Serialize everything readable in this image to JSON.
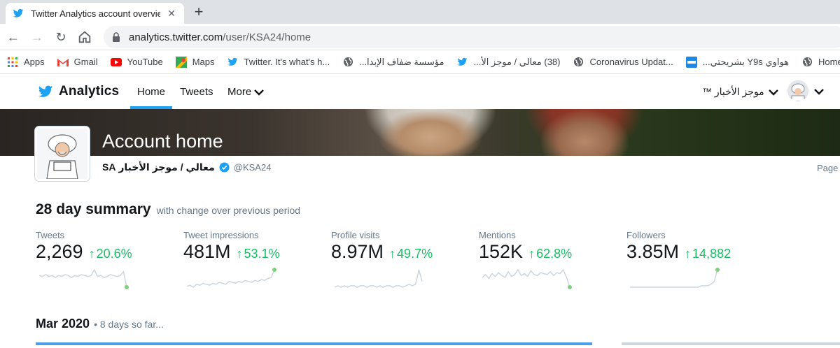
{
  "browser": {
    "tab_title": "Twitter Analytics account overvie",
    "url_domain": "analytics.twitter.com",
    "url_path": "/user/KSA24/home",
    "bookmarks": [
      {
        "label": "Apps",
        "icon": "apps-grid-icon"
      },
      {
        "label": "Gmail",
        "icon": "gmail-icon"
      },
      {
        "label": "YouTube",
        "icon": "youtube-icon"
      },
      {
        "label": "Maps",
        "icon": "maps-icon"
      },
      {
        "label": "Twitter. It's what's h...",
        "icon": "twitter-bird-icon"
      },
      {
        "label": "مؤسسة ضفاف الإبدا...",
        "icon": "globe-icon"
      },
      {
        "label": "(38) معالي / موجز الأ...",
        "icon": "twitter-bird-icon"
      },
      {
        "label": "Coronavirus Updat...",
        "icon": "globe-icon"
      },
      {
        "label": "هواوي Y9s بشريحتي...",
        "icon": "store-icon"
      },
      {
        "label": "Home -",
        "icon": "globe-icon"
      }
    ]
  },
  "nav": {
    "brand": "Analytics",
    "items": [
      "Home",
      "Tweets",
      "More"
    ],
    "account_name": "موجز الأخبار ™"
  },
  "header": {
    "title": "Account home",
    "display_name": "معالي / موجز الأخبار SA",
    "handle": "@KSA24",
    "page_link": "Page"
  },
  "summary": {
    "title": "28 day summary",
    "subtitle": "with change over previous period",
    "metrics": [
      {
        "label": "Tweets",
        "value": "2,269",
        "change": "20.6%",
        "spark": [
          6,
          5,
          7,
          5,
          6,
          4,
          6,
          5,
          7,
          6,
          4,
          6,
          5,
          7,
          6,
          5,
          6,
          12,
          5,
          6,
          4,
          5,
          7,
          6,
          5,
          6,
          10,
          -6
        ],
        "end_point": true
      },
      {
        "label": "Tweet impressions",
        "value": "481M",
        "change": "53.1%",
        "spark": [
          3,
          4,
          2,
          5,
          4,
          6,
          5,
          4,
          6,
          5,
          7,
          6,
          5,
          8,
          7,
          6,
          8,
          7,
          9,
          8,
          7,
          9,
          8,
          10,
          9,
          11,
          12,
          20
        ],
        "end_point": true
      },
      {
        "label": "Profile visits",
        "value": "8.97M",
        "change": "49.7%",
        "spark": [
          2,
          3,
          2,
          3,
          2,
          3,
          3,
          2,
          3,
          3,
          2,
          3,
          3,
          2,
          3,
          2,
          3,
          3,
          2,
          3,
          3,
          2,
          3,
          4,
          3,
          4,
          14,
          6
        ],
        "end_point": false
      },
      {
        "label": "Mentions",
        "value": "152K",
        "change": "62.8%",
        "spark": [
          4,
          7,
          3,
          8,
          5,
          9,
          6,
          4,
          10,
          5,
          7,
          12,
          6,
          8,
          5,
          11,
          7,
          6,
          9,
          8,
          7,
          10,
          6,
          9,
          8,
          12,
          4,
          -6
        ],
        "end_point": true
      },
      {
        "label": "Followers",
        "value": "3.85M",
        "change": "14,882",
        "spark": [
          2,
          2,
          2,
          2,
          2,
          2,
          2,
          2,
          2,
          2,
          2,
          2,
          2,
          2,
          2,
          2,
          2,
          2,
          2,
          2,
          2,
          2,
          3,
          3,
          3,
          4,
          6,
          14
        ],
        "end_point": true
      }
    ]
  },
  "month": {
    "title": "Mar 2020",
    "subtitle": "• 8 days so far..."
  },
  "colors": {
    "twitter_blue": "#1da1f2",
    "positive_green": "#17bf63",
    "spark_line": "#ccd6dd",
    "end_dot": "#7ed07e"
  }
}
